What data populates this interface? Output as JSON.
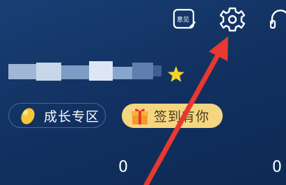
{
  "header": {
    "feedback_icon": "feedback-icon",
    "feedback_label": "意见",
    "settings_icon": "gear-icon",
    "support_icon": "headset-icon"
  },
  "profile": {
    "username": "",
    "badge_icon": "star-icon",
    "badge_color": "#f5d22b"
  },
  "buttons": {
    "growth_zone": "成长专区",
    "checkin": "签到有你"
  },
  "stats": [
    {
      "value": "0"
    },
    {
      "value": "0"
    }
  ],
  "colors": {
    "background": "#123262",
    "checkin_bg": "#f5d680",
    "arrow": "#e8382f"
  }
}
